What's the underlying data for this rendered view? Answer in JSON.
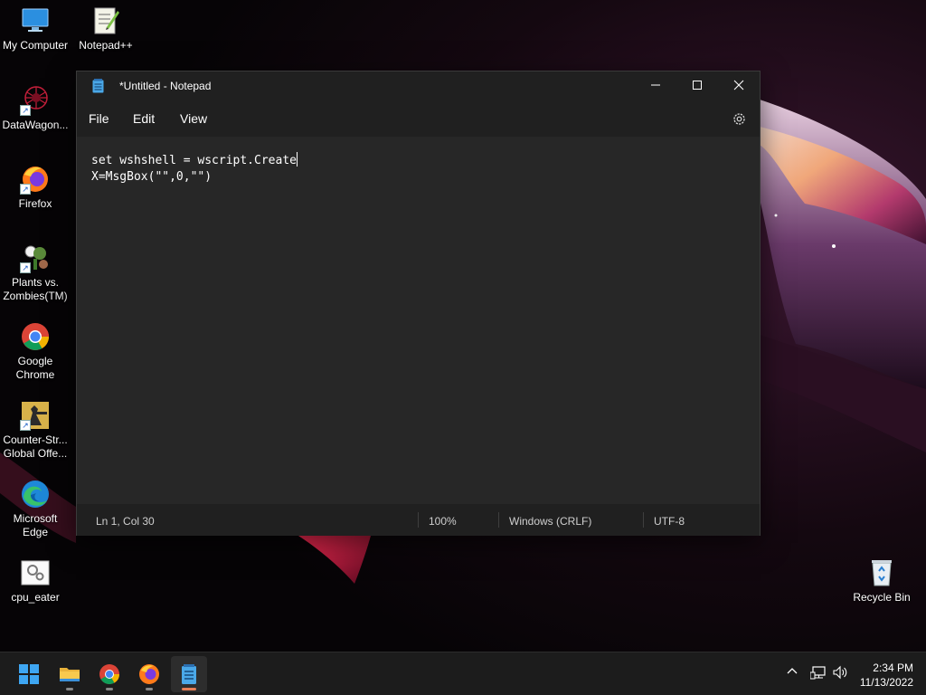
{
  "desktop": {
    "icons": [
      {
        "label": "My Computer"
      },
      {
        "label": "Notepad++"
      },
      {
        "label": "DataWagon..."
      },
      {
        "label": "Firefox"
      },
      {
        "label": "Plants vs. Zombies(TM)"
      },
      {
        "label": "Google Chrome"
      },
      {
        "label": "Counter-Str... Global Offe..."
      },
      {
        "label": "Microsoft Edge"
      },
      {
        "label": "cpu_eater"
      },
      {
        "label": "Recycle Bin"
      }
    ]
  },
  "notepad": {
    "title": "*Untitled - Notepad",
    "menu": [
      "File",
      "Edit",
      "View"
    ],
    "content_lines": [
      "set wshshell = wscript.Create",
      "X=MsgBox(\"\",0,\"\")"
    ],
    "status": {
      "position": "Ln 1, Col 30",
      "zoom": "100%",
      "line_ending": "Windows (CRLF)",
      "encoding": "UTF-8"
    }
  },
  "taskbar": {
    "apps": [
      "start-icon",
      "file-explorer-icon",
      "chrome-icon",
      "firefox-icon",
      "notepad-icon"
    ],
    "clock": {
      "time": "2:34 PM",
      "date": "11/13/2022"
    }
  },
  "colors": {
    "accent_indicator": "#e67e56",
    "window_bg": "#202020",
    "editor_bg": "#272727"
  }
}
